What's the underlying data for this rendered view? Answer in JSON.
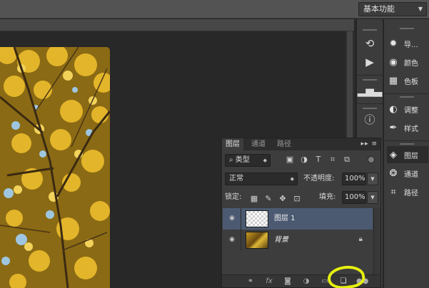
{
  "topbar": {
    "workspace_label": "基本功能"
  },
  "dock_narrow": {
    "icons": [
      "history-icon",
      "play-icon",
      "histogram-icon",
      "info-icon"
    ]
  },
  "dock_wide": {
    "items": [
      {
        "label": "导...",
        "icon": "navigator-icon"
      },
      {
        "label": "颜色",
        "icon": "color-icon"
      },
      {
        "label": "色板",
        "icon": "swatches-icon"
      },
      {
        "label": "调整",
        "icon": "adjustments-icon"
      },
      {
        "label": "样式",
        "icon": "styles-icon"
      },
      {
        "label": "图层",
        "icon": "layers-icon",
        "active": true
      },
      {
        "label": "通道",
        "icon": "channels-icon"
      },
      {
        "label": "路径",
        "icon": "paths-icon"
      }
    ]
  },
  "layers_panel": {
    "tabs": [
      "图层",
      "通道",
      "路径"
    ],
    "active_tab": "图层",
    "filter_label": "类型",
    "blend_mode": "正常",
    "opacity_label": "不透明度:",
    "opacity_value": "100%",
    "lock_label": "锁定:",
    "fill_label": "填充:",
    "fill_value": "100%",
    "layers": [
      {
        "name": "图层 1",
        "selected": true
      },
      {
        "name": "背景",
        "selected": false,
        "locked": true
      }
    ],
    "footer_icons": [
      "link-layers-icon",
      "fx-icon",
      "add-mask-icon",
      "adjustment-layer-icon",
      "group-icon",
      "new-layer-icon",
      "delete-icon"
    ]
  },
  "colors": {
    "selected_row": "#4b5a71",
    "highlight_circle": "#e6f00f"
  }
}
